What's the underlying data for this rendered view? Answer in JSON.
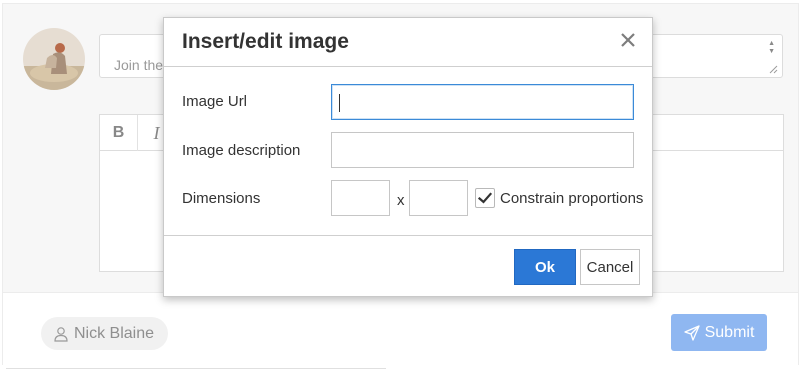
{
  "page": {
    "join_placeholder": "Join the discussion...",
    "user_name": "Nick Blaine",
    "submit_label": "Submit",
    "toolbar": {
      "bold": "B",
      "italic": "I"
    }
  },
  "dialog": {
    "title": "Insert/edit image",
    "image_url_label": "Image Url",
    "image_url_value": "",
    "image_description_label": "Image description",
    "image_description_value": "",
    "dimensions_label": "Dimensions",
    "width_value": "",
    "height_value": "",
    "dimension_separator": "x",
    "constrain_label": "Constrain proportions",
    "constrain_checked": true,
    "ok_label": "Ok",
    "cancel_label": "Cancel"
  },
  "colors": {
    "primary": "#2b78d6",
    "submit_disabled": "#8fb7f1",
    "focus_border": "#3b8ad8"
  },
  "icons": [
    "close-icon",
    "checkmark-icon",
    "user-icon",
    "send-icon",
    "resize-grip-icon",
    "spinner-arrows-icon"
  ]
}
